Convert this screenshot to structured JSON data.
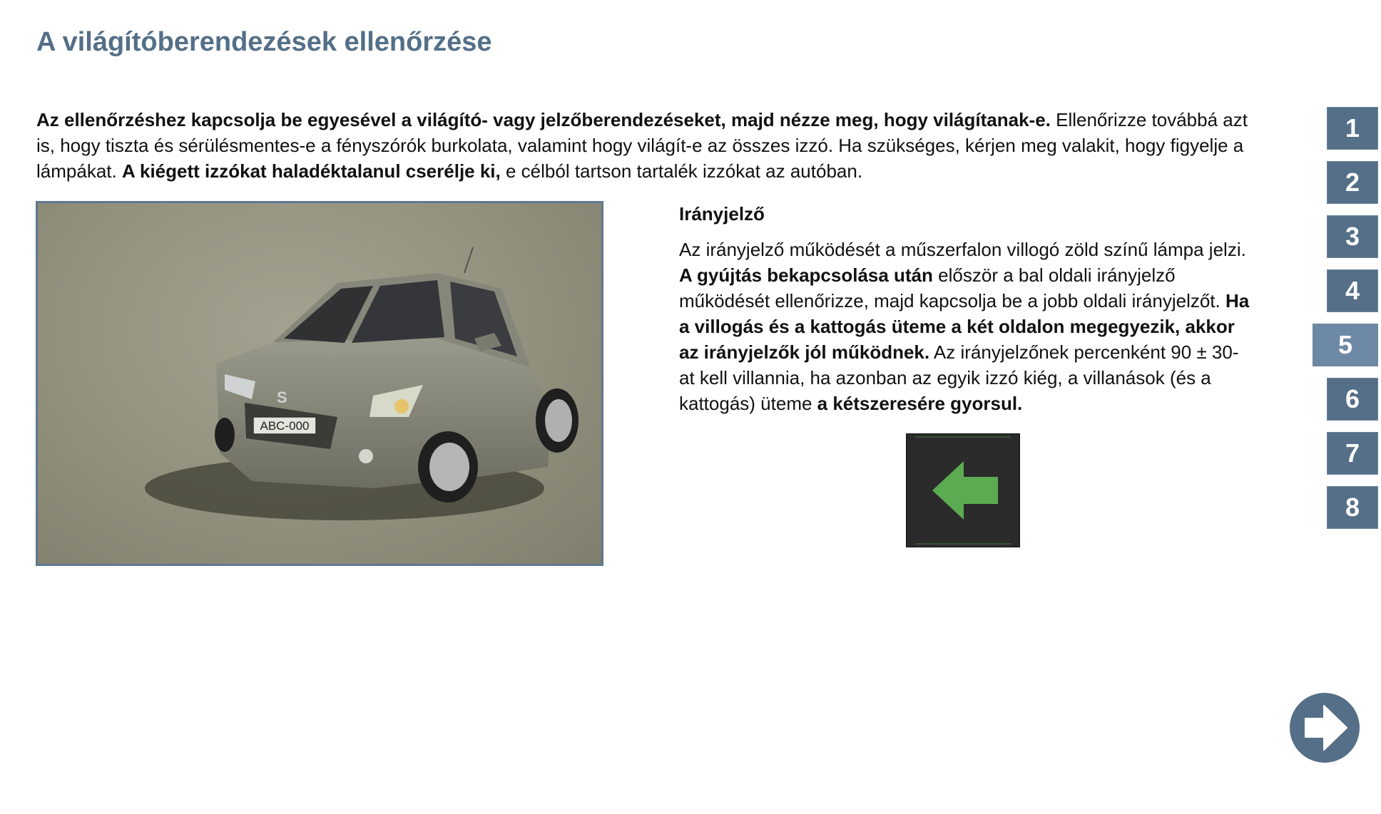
{
  "page": {
    "title": "A világítóberendezések ellenőrzése"
  },
  "intro": [
    {
      "text": "Az ellenőrzéshez kapcsolja be egyesével a világító- vagy jelzőberendezéseket, majd nézze meg, hogy világítanak-e.",
      "bold": true
    },
    {
      "text": " Ellenőrizze továbbá azt is, hogy tiszta és sérülésmentes-e a fényszórók burkolata, valamint hogy világít-e az összes izzó. Ha szükséges, kérjen meg valakit, hogy figyelje a lámpákat. ",
      "bold": false
    },
    {
      "text": "A kiégett izzókat haladéktalanul cserélje ki,",
      "bold": true
    },
    {
      "text": " e célból tartson tartalék izzókat az autóban.",
      "bold": false
    }
  ],
  "car_image": {
    "plate": "ABC-000",
    "brand_mark": "S"
  },
  "section": {
    "title": "Irányjelző",
    "body": [
      {
        "text": "Az irányjelző működését a műszerfalon villogó zöld színű lámpa jelzi. ",
        "bold": false
      },
      {
        "text": "A gyújtás bekapcsolása után",
        "bold": true
      },
      {
        "text": " először a bal oldali irányjelző működését ellenőrizze, majd kapcsolja be a jobb oldali irányjelzőt. ",
        "bold": false
      },
      {
        "text": "Ha a villogás és a kattogás üteme a két oldalon megegyezik, akkor az irányjelzők jól működnek.",
        "bold": true
      },
      {
        "text": " Az irányjelzőnek percenként 90 ± 30-at kell villannia, ha azonban az egyik izzó kiég, a villanások (és a kattogás) üteme ",
        "bold": false
      },
      {
        "text": "a kétszeresére gyorsul.",
        "bold": true
      }
    ]
  },
  "signal_icon": {
    "name": "turn-signal-left-arrow-icon",
    "color": "#5cab52",
    "background": "#2b2b2b"
  },
  "nav": {
    "items": [
      "1",
      "2",
      "3",
      "4",
      "5",
      "6",
      "7",
      "8"
    ],
    "active": "5"
  },
  "next_button": {
    "icon": "arrow-right-icon"
  },
  "colors": {
    "accent": "#546f87",
    "accent_active": "#6d89a6",
    "text": "#111111"
  }
}
